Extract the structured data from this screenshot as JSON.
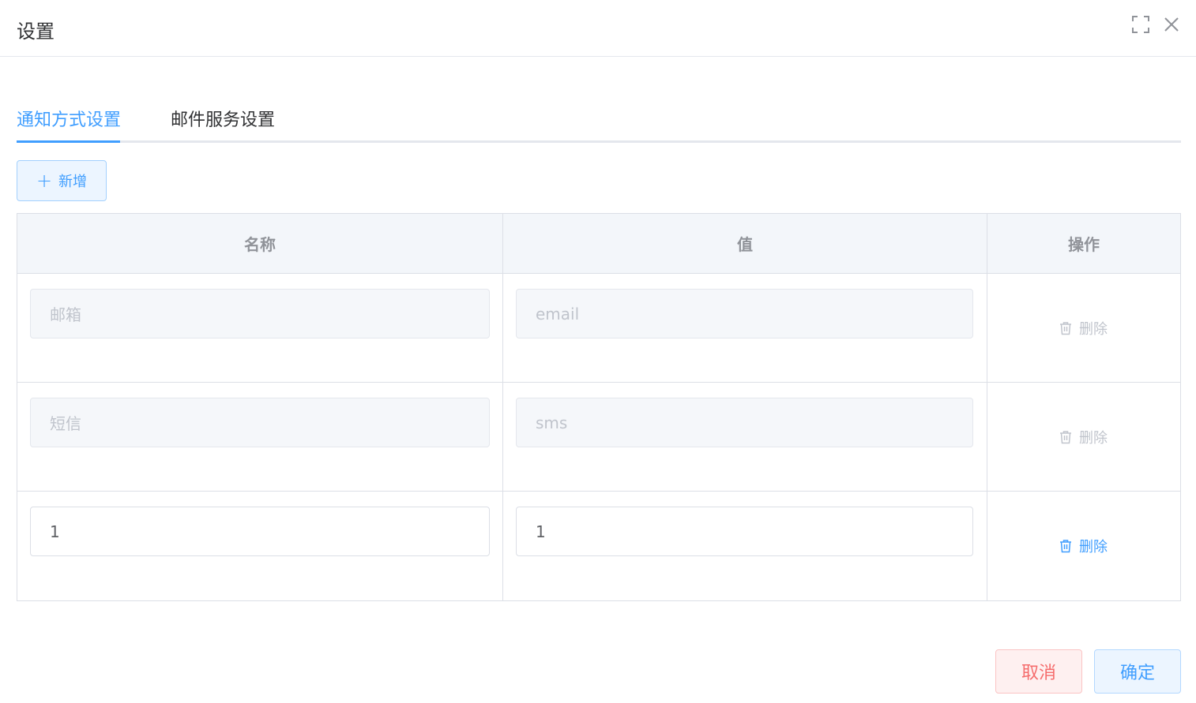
{
  "dialog": {
    "title": "设置"
  },
  "tabs": [
    {
      "label": "通知方式设置",
      "active": true
    },
    {
      "label": "邮件服务设置",
      "active": false
    }
  ],
  "toolbar": {
    "add_label": "新增"
  },
  "table": {
    "headers": [
      "名称",
      "值",
      "操作"
    ],
    "rows": [
      {
        "name": "邮箱",
        "value": "email",
        "action": "删除",
        "disabled": true
      },
      {
        "name": "短信",
        "value": "sms",
        "action": "删除",
        "disabled": true
      },
      {
        "name": "1",
        "value": "1",
        "action": "删除",
        "disabled": false
      }
    ]
  },
  "footer": {
    "cancel_label": "取消",
    "confirm_label": "确定"
  },
  "colors": {
    "primary": "#409eff",
    "danger": "#f56c6c",
    "disabled_text": "#c0c4cc"
  }
}
